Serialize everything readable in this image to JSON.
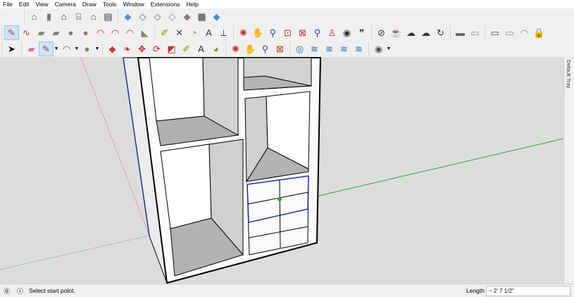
{
  "menu": [
    "File",
    "Edit",
    "View",
    "Camera",
    "Draw",
    "Tools",
    "Window",
    "Extensions",
    "Help"
  ],
  "toolbar_rows": [
    [
      [
        {
          "n": "iso-view",
          "g": "⌂",
          "c": "#555"
        },
        {
          "n": "top-view",
          "g": "▮",
          "c": "#777"
        },
        {
          "n": "front-view",
          "g": "⌂",
          "c": "#222"
        },
        {
          "n": "right-view",
          "g": "⌸",
          "c": "#333"
        },
        {
          "n": "back-view",
          "g": "⌂",
          "c": "#444"
        },
        {
          "n": "left-view",
          "g": "▤",
          "c": "#333"
        }
      ],
      [
        {
          "n": "xray",
          "g": "◆",
          "c": "#5b8fc7"
        },
        {
          "n": "wireframe",
          "g": "◇",
          "c": "#666"
        },
        {
          "n": "hidden-line",
          "g": "◇",
          "c": "#666"
        },
        {
          "n": "shaded",
          "g": "◇",
          "c": "#888"
        },
        {
          "n": "shaded-textures",
          "g": "◆",
          "c": "#8a8070"
        },
        {
          "n": "monochrome",
          "g": "▦",
          "c": "#333"
        },
        {
          "n": "back-edges",
          "g": "◆",
          "c": "#4a8bc4"
        }
      ]
    ],
    [
      [
        {
          "n": "line",
          "g": "✎",
          "c": "#c03030",
          "a": true
        },
        {
          "n": "freehand",
          "g": "∿",
          "c": "#c03030"
        },
        {
          "n": "rectangle",
          "g": "▰",
          "c": "#8a7f70"
        },
        {
          "n": "rotated-rectangle",
          "g": "▰",
          "c": "#8a7f70"
        },
        {
          "n": "circle",
          "g": "●",
          "c": "#8a7f70"
        },
        {
          "n": "polygon",
          "g": "●",
          "c": "#b07070"
        },
        {
          "n": "arc",
          "g": "◠",
          "c": "#c03030"
        },
        {
          "n": "2pt-arc",
          "g": "◠",
          "c": "#c03030"
        },
        {
          "n": "3pt-arc",
          "g": "◠",
          "c": "#c03030"
        },
        {
          "n": "pie",
          "g": "◣",
          "c": "#8a7f70"
        }
      ],
      [
        {
          "n": "tape-measure",
          "g": "✐",
          "c": "#8a8a00"
        },
        {
          "n": "dimension",
          "g": "✕",
          "c": "#444"
        },
        {
          "n": "protractor",
          "g": "◔",
          "c": "#8a8a00"
        },
        {
          "n": "text",
          "g": "A",
          "c": "#333"
        },
        {
          "n": "axes",
          "g": "⟂",
          "c": "#444"
        }
      ],
      [
        {
          "n": "orbit",
          "g": "✺",
          "c": "#c03030"
        },
        {
          "n": "pan",
          "g": "✋",
          "c": "#c0a060"
        },
        {
          "n": "zoom",
          "g": "⚲",
          "c": "#2050a0"
        },
        {
          "n": "zoom-window",
          "g": "⊡",
          "c": "#c03030"
        },
        {
          "n": "zoom-extents",
          "g": "⊠",
          "c": "#c03030"
        },
        {
          "n": "previous",
          "g": "⚲",
          "c": "#2050a0"
        },
        {
          "n": "position-camera",
          "g": "♙",
          "c": "#c03030"
        },
        {
          "n": "look-around",
          "g": "◉",
          "c": "#333"
        },
        {
          "n": "walk",
          "g": "❞",
          "c": "#333"
        }
      ],
      [
        {
          "n": "model-info",
          "g": "⊘",
          "c": "#333"
        },
        {
          "n": "warehouse",
          "g": "☕",
          "c": "#333"
        },
        {
          "n": "share-model",
          "g": "☁",
          "c": "#333"
        },
        {
          "n": "extension-warehouse",
          "g": "☁",
          "c": "#333"
        },
        {
          "n": "refresh",
          "g": "↻",
          "c": "#333"
        }
      ],
      [
        {
          "n": "section-plane",
          "g": "▬",
          "c": "#666"
        },
        {
          "n": "section-display",
          "g": "▭",
          "c": "#888"
        }
      ],
      [
        {
          "n": "window-ui",
          "g": "▭",
          "c": "#444"
        },
        {
          "n": "layers",
          "g": "▭",
          "c": "#888"
        },
        {
          "n": "shadows",
          "g": "◠",
          "c": "#888"
        },
        {
          "n": "lock",
          "g": "🔒",
          "c": "#aaa"
        }
      ]
    ],
    [
      [
        {
          "n": "select",
          "g": "➤",
          "c": "#000"
        }
      ],
      [
        {
          "n": "eraser",
          "g": "▰",
          "c": "#e07090"
        },
        {
          "n": "line",
          "g": "✎",
          "c": "#c03030",
          "a": true,
          "d": true
        },
        {
          "n": "arc",
          "g": "◠",
          "c": "#c03030",
          "d": true
        },
        {
          "n": "circle",
          "g": "●",
          "c": "#8a7f70",
          "d": true
        }
      ],
      [
        {
          "n": "push-pull",
          "g": "◆",
          "c": "#c04040"
        },
        {
          "n": "follow-me",
          "g": "❧",
          "c": "#c03030"
        },
        {
          "n": "move",
          "g": "✥",
          "c": "#d02020"
        },
        {
          "n": "rotate",
          "g": "⟳",
          "c": "#d02020"
        },
        {
          "n": "scale",
          "g": "◩",
          "c": "#c03030"
        },
        {
          "n": "tape",
          "g": "✐",
          "c": "#8a8a00"
        },
        {
          "n": "text",
          "g": "A",
          "c": "#333"
        },
        {
          "n": "paint-bucket",
          "g": "◕",
          "c": "#8a8a00"
        }
      ],
      [
        {
          "n": "orbit",
          "g": "✺",
          "c": "#c03030"
        },
        {
          "n": "pan",
          "g": "✋",
          "c": "#c0a060"
        },
        {
          "n": "zoom",
          "g": "⚲",
          "c": "#2050a0"
        },
        {
          "n": "zoom-extents",
          "g": "⊠",
          "c": "#c03030"
        }
      ],
      [
        {
          "n": "sandbox-from-contours",
          "g": "◎",
          "c": "#2060b0"
        },
        {
          "n": "sandbox-from-scratch",
          "g": "≋",
          "c": "#2060b0"
        },
        {
          "n": "smoove",
          "g": "≋",
          "c": "#2060b0"
        },
        {
          "n": "stamp",
          "g": "≋",
          "c": "#2060b0"
        },
        {
          "n": "drape",
          "g": "≋",
          "c": "#2060b0"
        }
      ],
      [
        {
          "n": "user-account",
          "g": "◉",
          "c": "#555",
          "d": true
        }
      ]
    ]
  ],
  "tray_label": "Default Tray",
  "status": {
    "hint": "Select start point.",
    "measure_label": "Length",
    "measure_value": "~ 2' 7 1/2\""
  }
}
